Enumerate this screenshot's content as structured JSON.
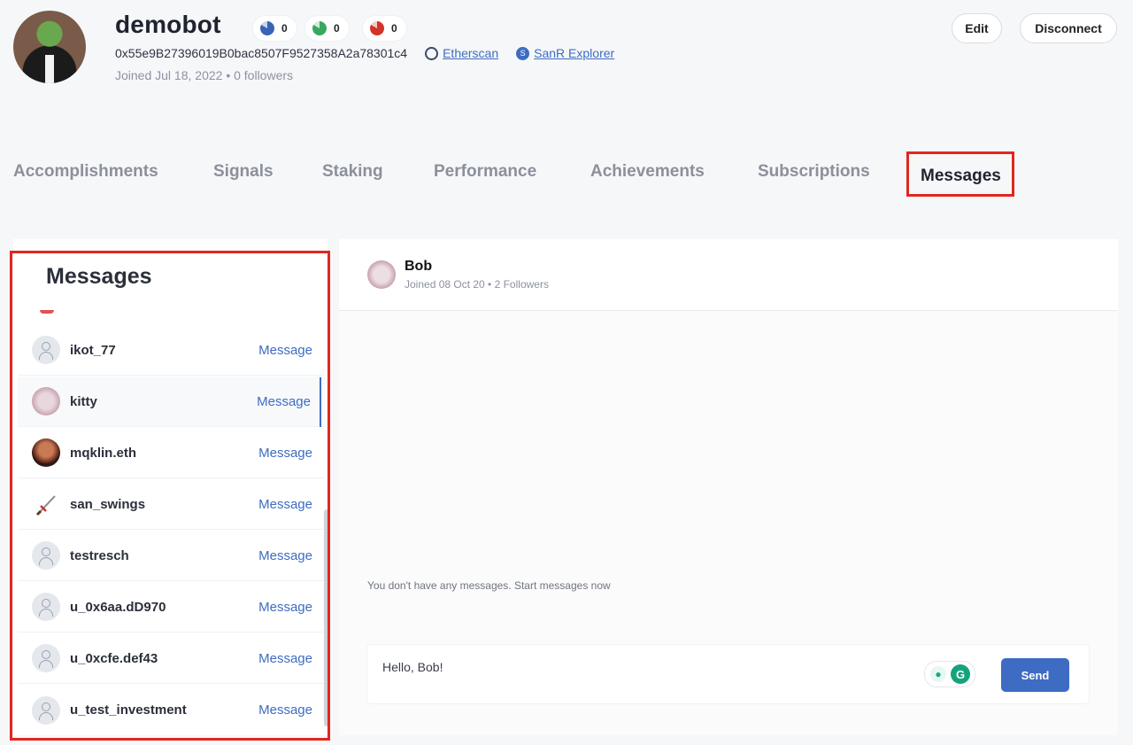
{
  "profile": {
    "username": "demobot",
    "badges": [
      {
        "icon": "signal-badge-icon",
        "count": "0",
        "color": "#3b63b5"
      },
      {
        "icon": "staking-badge-icon",
        "count": "0",
        "color": "#3aa760"
      },
      {
        "icon": "achievement-badge-icon",
        "count": "0",
        "color": "#d2332a"
      }
    ],
    "address": "0x55e9B27396019B0bac8507F9527358A2a78301c4",
    "etherscan_label": "Etherscan",
    "sanr_label": "SanR Explorer",
    "joined": "Joined Jul 18, 2022 • 0 followers"
  },
  "actions": {
    "edit": "Edit",
    "disconnect": "Disconnect"
  },
  "tabs": [
    "Accomplishments",
    "Signals",
    "Staking",
    "Performance",
    "Achievements",
    "Subscriptions",
    "Messages"
  ],
  "active_tab": "Messages",
  "messages_panel": {
    "title": "Messages",
    "contacts": [
      {
        "name": "ikot_77",
        "action": "Message",
        "avatar": "default"
      },
      {
        "name": "kitty",
        "action": "Message",
        "avatar": "blurred",
        "selected": true
      },
      {
        "name": "mqklin.eth",
        "action": "Message",
        "avatar": "photo"
      },
      {
        "name": "san_swings",
        "action": "Message",
        "avatar": "sword"
      },
      {
        "name": "testresch",
        "action": "Message",
        "avatar": "default"
      },
      {
        "name": "u_0x6aa.dD970",
        "action": "Message",
        "avatar": "default"
      },
      {
        "name": "u_0xcfe.def43",
        "action": "Message",
        "avatar": "default"
      },
      {
        "name": "u_test_investment",
        "action": "Message",
        "avatar": "default"
      }
    ]
  },
  "chat": {
    "name": "Bob",
    "subtitle": "Joined 08 Oct 20 • 2 Followers",
    "empty_text": "You don't have any messages. Start messages now",
    "input_value": "Hello, Bob!",
    "send_label": "Send"
  },
  "colors": {
    "accent": "#3d6cc2",
    "highlight": "#e0271f"
  }
}
